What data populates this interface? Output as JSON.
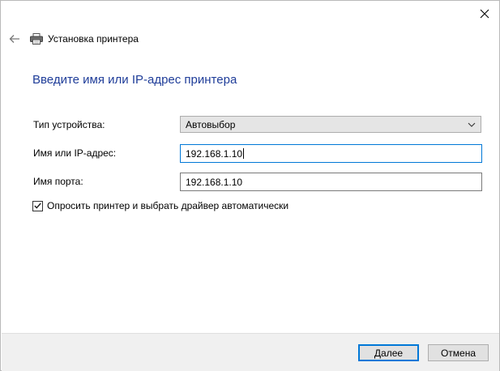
{
  "window": {
    "title": "Установка принтера"
  },
  "icons": {
    "close": "close-icon",
    "back": "back-arrow-icon",
    "printer": "printer-icon",
    "dropdown": "chevron-down-icon",
    "check": "checkmark-icon"
  },
  "main": {
    "heading": "Введите имя или IP-адрес принтера",
    "device_type": {
      "label": "Тип устройства:",
      "value": "Автовыбор"
    },
    "host": {
      "label": "Имя или IP-адрес:",
      "value": "192.168.1.10"
    },
    "port": {
      "label": "Имя порта:",
      "value": "192.168.1.10"
    },
    "auto_driver": {
      "label": "Опросить принтер и выбрать драйвер автоматически",
      "checked": true
    }
  },
  "footer": {
    "next_label": "Далее",
    "cancel_label": "Отмена"
  },
  "colors": {
    "heading": "#1f3d99",
    "accent": "#0078d7",
    "footer_bg": "#f0f0f0"
  }
}
